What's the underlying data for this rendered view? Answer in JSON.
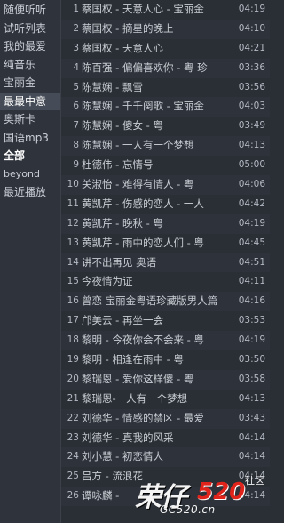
{
  "sidebar": {
    "items": [
      {
        "label": "随便听听"
      },
      {
        "label": "试听列表"
      },
      {
        "label": "我的最爱"
      },
      {
        "label": "纯音乐"
      },
      {
        "label": "宝丽金"
      },
      {
        "label": "最最中意"
      },
      {
        "label": "奥斯卡"
      },
      {
        "label": "国语mp3"
      },
      {
        "label": "全部"
      },
      {
        "label": "beyond"
      },
      {
        "label": "最近播放"
      }
    ]
  },
  "tracks": [
    {
      "index": "1",
      "title": "蔡国权 - 天意人心 - 宝丽金",
      "duration": "04:19"
    },
    {
      "index": "2",
      "title": "蔡国权 - 摘星的晚上",
      "duration": "04:10"
    },
    {
      "index": "3",
      "title": "蔡国权 - 天意人心",
      "duration": "04:21"
    },
    {
      "index": "4",
      "title": "陈百强 - 偏偏喜欢你 - 粤 珍",
      "duration": "03:36"
    },
    {
      "index": "5",
      "title": "陈慧娴 - 飘雪",
      "duration": "03:56"
    },
    {
      "index": "6",
      "title": "陈慧娴 - 千千阕歌 - 宝丽金",
      "duration": "04:03"
    },
    {
      "index": "7",
      "title": "陈慧娴 - 傻女 - 粤",
      "duration": "03:49"
    },
    {
      "index": "8",
      "title": "陈慧娴 - 一人有一个梦想",
      "duration": "04:13"
    },
    {
      "index": "9",
      "title": "杜德伟 - 忘情号",
      "duration": "05:00"
    },
    {
      "index": "10",
      "title": "关淑怡 - 难得有情人 - 粤",
      "duration": "04:06"
    },
    {
      "index": "11",
      "title": "黄凯芹 - 伤感的恋人 - 一人",
      "duration": "04:42"
    },
    {
      "index": "12",
      "title": "黄凯芹 - 晚秋 - 粤",
      "duration": "04:19"
    },
    {
      "index": "13",
      "title": "黄凯芹 - 雨中的恋人们 - 粤",
      "duration": "04:45"
    },
    {
      "index": "14",
      "title": "讲不出再见 奥语",
      "duration": "04:51"
    },
    {
      "index": "15",
      "title": "今夜情为证",
      "duration": "04:11"
    },
    {
      "index": "16",
      "title": "曾恋 宝丽金粤语珍藏版男人篇",
      "duration": "04:16"
    },
    {
      "index": "17",
      "title": "邝美云 - 再坐一会",
      "duration": "03:53"
    },
    {
      "index": "18",
      "title": "黎明 - 今夜你会不会来 - 粤",
      "duration": "04:19"
    },
    {
      "index": "19",
      "title": "黎明 - 相逢在雨中 - 粤",
      "duration": "03:50"
    },
    {
      "index": "20",
      "title": "黎瑞恩 - 爱你这样傻 - 粤",
      "duration": "03:58"
    },
    {
      "index": "21",
      "title": "黎瑞恩-一人有一个梦想",
      "duration": "04:13"
    },
    {
      "index": "22",
      "title": "刘德华 - 情感的禁区 - 最爱",
      "duration": "03:43"
    },
    {
      "index": "23",
      "title": "刘德华 - 真我的风采",
      "duration": "04:14"
    },
    {
      "index": "24",
      "title": "刘小慧 - 初恋情人",
      "duration": "04:14"
    },
    {
      "index": "25",
      "title": "吕方 - 流浪花",
      "duration": "04:14"
    },
    {
      "index": "26",
      "title": "谭咏麟 - ",
      "duration": "04:14"
    }
  ],
  "watermark": {
    "brand": "荣仔",
    "number": "520",
    "site_label": "社区",
    "url": "GC520.cn"
  },
  "colors": {
    "background": "#2a2e35",
    "sidebar_background": "#2f333b",
    "active_item": "#464c57",
    "text": "#c8ccd3",
    "watermark_red": "#e0241b"
  }
}
